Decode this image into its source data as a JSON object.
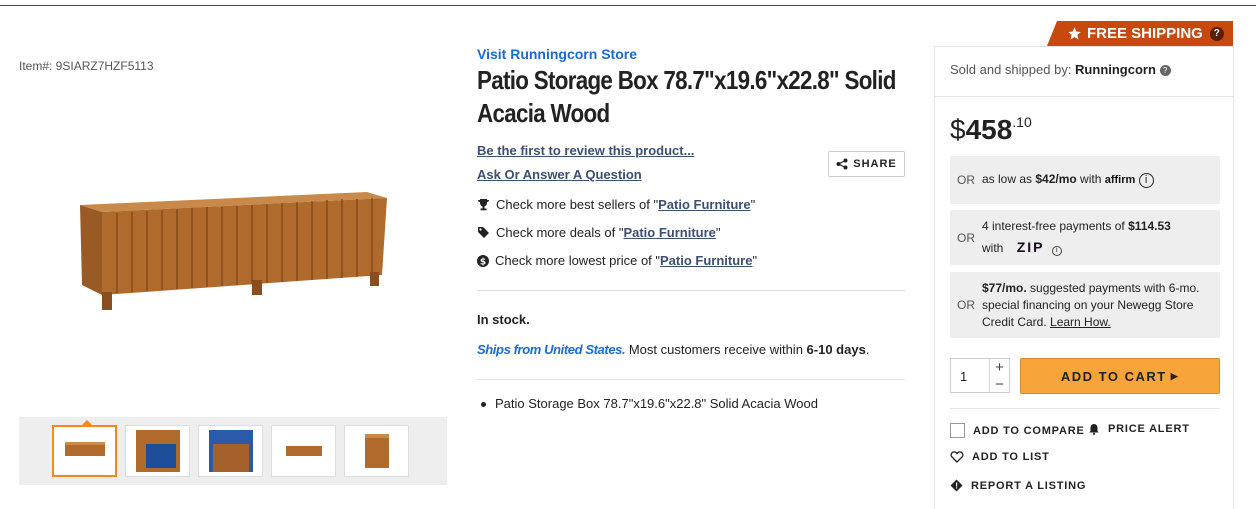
{
  "item_number": "Item#: 9SIARZ7HZF5113",
  "store_link": "Visit Runningcorn Store",
  "title": "Patio Storage Box 78.7\"x19.6\"x22.8\" Solid Acacia Wood",
  "review_link": "Be the first to review this product...",
  "qa_link": "Ask Or Answer A Question",
  "share_label": "SHARE",
  "checks": [
    {
      "prefix": "Check more best sellers of \"",
      "link": "Patio Furniture",
      "suffix": "\"",
      "icon": "trophy-icon"
    },
    {
      "prefix": "Check more deals of \"",
      "link": "Patio Furniture",
      "suffix": "\"",
      "icon": "tags-icon"
    },
    {
      "prefix": "Check more lowest price of \"",
      "link": "Patio Furniture",
      "suffix": "\"",
      "icon": "dollar-icon"
    }
  ],
  "stock": "In stock.",
  "ships_from": "Ships from United States.",
  "ships_text": " Most customers receive within ",
  "ships_days": "6-10 days",
  "ships_end": ".",
  "bullet": "Patio Storage Box 78.7\"x19.6\"x22.8\" Solid Acacia Wood",
  "free_shipping": "FREE SHIPPING",
  "sold_by_label": "Sold and shipped by: ",
  "sold_by": "Runningcorn",
  "price": {
    "currency": "$",
    "dollars": "458",
    "cents": ".10"
  },
  "or_label": "OR",
  "affirm": {
    "text": "as low as ",
    "amount": "$42/mo",
    "with": " with ",
    "brand": "affirm"
  },
  "zip": {
    "line1": "4 interest-free payments of ",
    "amount": "$114.53",
    "line2": "with",
    "brand": "ZIP"
  },
  "newegg_card": {
    "amount": "$77/mo.",
    "text": " suggested payments with 6-mo. special financing on your Newegg Store Credit Card. ",
    "link": "Learn How."
  },
  "quantity": "1",
  "add_to_cart": "ADD TO CART",
  "add_to_compare": "ADD TO COMPARE",
  "price_alert": "PRICE ALERT",
  "add_to_list": "ADD TO LIST",
  "report_listing": "REPORT A LISTING",
  "colors": {
    "accent": "#f7a43a",
    "free_ship": "#c8490e",
    "link": "#1a6ad6"
  }
}
